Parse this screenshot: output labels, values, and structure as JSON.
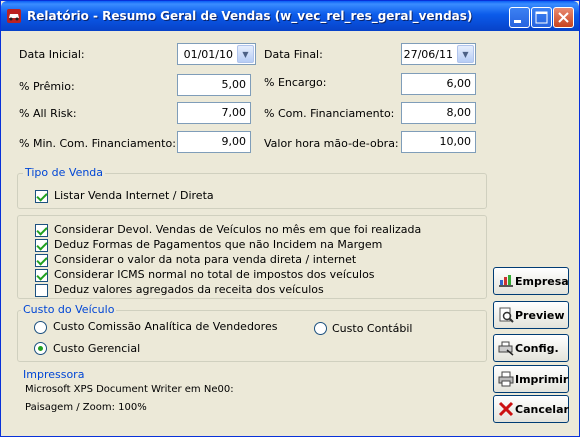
{
  "window": {
    "title": "Relatório - Resumo Geral de Vendas (w_vec_rel_res_geral_vendas)",
    "min_label": "_",
    "max_label": "□",
    "close_label": "✕"
  },
  "fields": {
    "data_inicial": {
      "label": "Data Inicial:",
      "value": "01/01/10"
    },
    "data_final": {
      "label": "Data Final:",
      "value": "27/06/11"
    },
    "premio": {
      "label": "% Prêmio:",
      "value": "5,00"
    },
    "encargo": {
      "label": "% Encargo:",
      "value": "6,00"
    },
    "all_risk": {
      "label": "% All Risk:",
      "value": "7,00"
    },
    "com_financiamento": {
      "label": "% Com. Financiamento:",
      "value": "8,00"
    },
    "min_com_financiamento": {
      "label": "% Min. Com. Financiamento:",
      "value": "9,00"
    },
    "valor_hora": {
      "label": "Valor hora mão-de-obra:",
      "value": "10,00"
    }
  },
  "tipo_venda": {
    "title": "Tipo de Venda",
    "listar_internet": {
      "label": "Listar Venda Internet / Direta",
      "checked": true
    }
  },
  "options": [
    {
      "label": "Considerar Devol. Vendas de Veículos no mês em que foi realizada",
      "checked": true
    },
    {
      "label": "Deduz Formas de Pagamentos que não Incidem na Margem",
      "checked": true
    },
    {
      "label": "Considerar o valor da nota para venda direta / internet",
      "checked": true
    },
    {
      "label": "Considerar ICMS normal no total de impostos dos veículos",
      "checked": true
    },
    {
      "label": "Deduz valores agregados da receita dos veículos",
      "checked": false
    }
  ],
  "custo_veiculo": {
    "title": "Custo do Veículo",
    "comissao": {
      "label": "Custo Comissão Analítica de Vendedores",
      "selected": false
    },
    "contabil": {
      "label": "Custo Contábil",
      "selected": false
    },
    "gerencial": {
      "label": "Custo Gerencial",
      "selected": true
    }
  },
  "impressora": {
    "title": "Impressora",
    "printer": "Microsoft XPS Document Writer em Ne00:",
    "layout": "Paisagem / Zoom: 100%"
  },
  "buttons": {
    "empresa": "Empresa",
    "preview": "Preview",
    "config": "Config.",
    "imprimir": "Imprimir",
    "cancelar": "Cancelar"
  },
  "colors": {
    "group_title": "#0046D5",
    "check_mark": "#21A121",
    "titlebar": "#0A5FF5"
  }
}
